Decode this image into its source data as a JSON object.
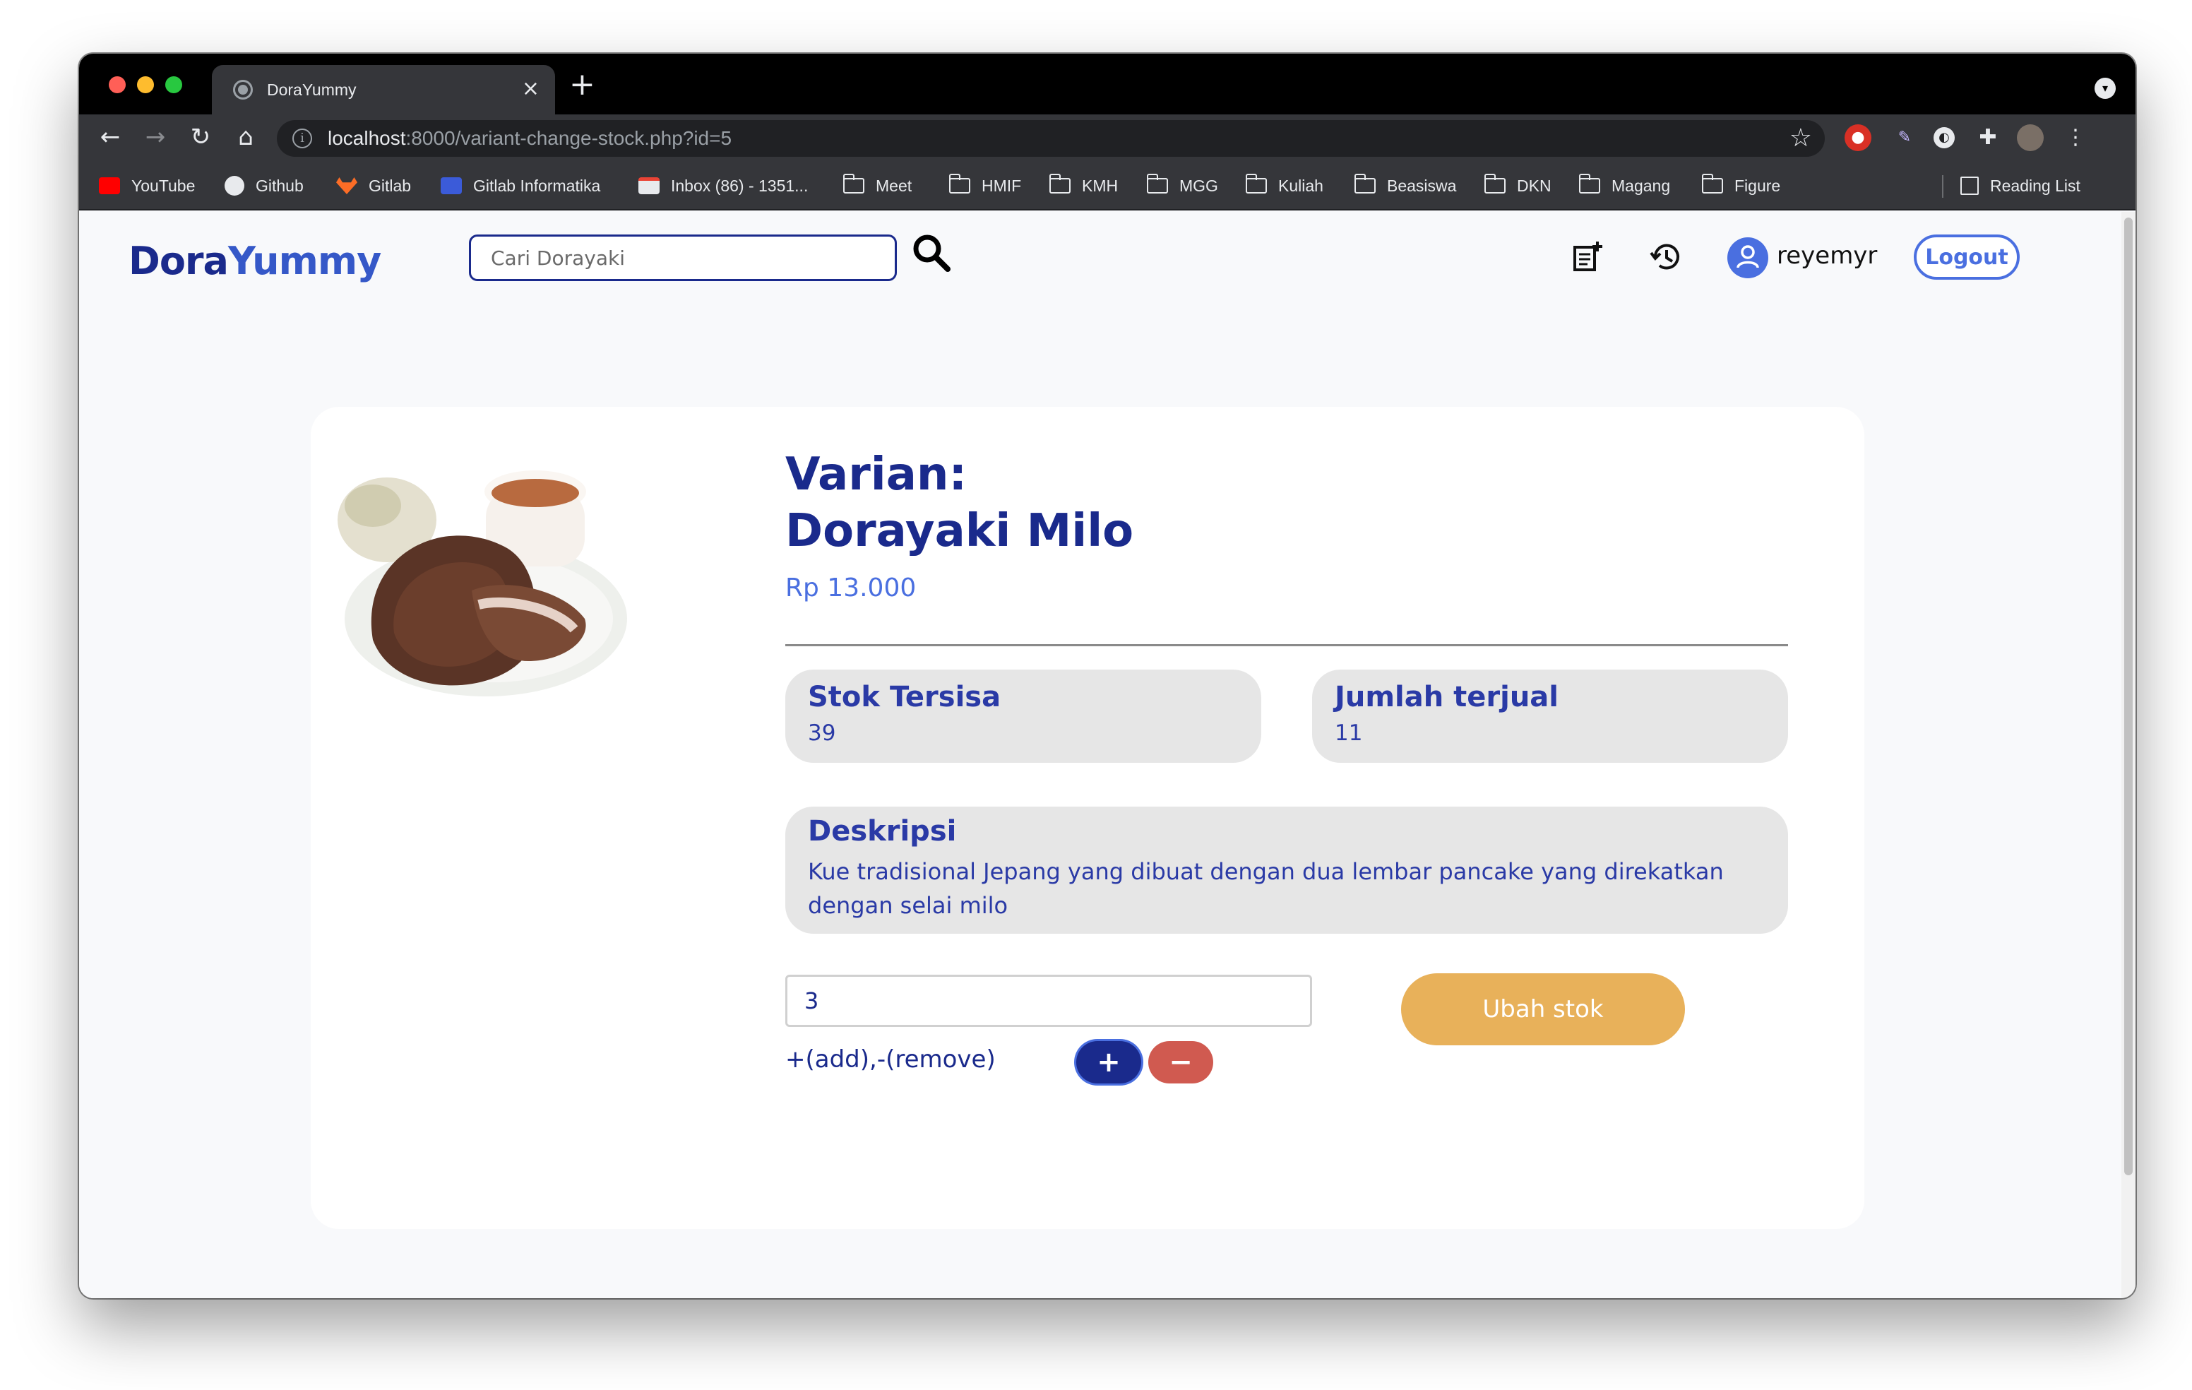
{
  "browser": {
    "tab_title": "DoraYummy",
    "url_host": "localhost",
    "url_rest": ":8000/variant-change-stock.php?id=5",
    "bookmarks": [
      {
        "label": "YouTube",
        "icon": "youtube-icon"
      },
      {
        "label": "Github",
        "icon": "github-icon"
      },
      {
        "label": "Gitlab",
        "icon": "gitlab-icon"
      },
      {
        "label": "Gitlab Informatika",
        "icon": "gitlab-informatika-icon"
      },
      {
        "label": "Inbox (86) - 1351...",
        "icon": "gmail-icon"
      },
      {
        "label": "Meet",
        "icon": "folder-icon"
      },
      {
        "label": "HMIF",
        "icon": "folder-icon"
      },
      {
        "label": "KMH",
        "icon": "folder-icon"
      },
      {
        "label": "MGG",
        "icon": "folder-icon"
      },
      {
        "label": "Kuliah",
        "icon": "folder-icon"
      },
      {
        "label": "Beasiswa",
        "icon": "folder-icon"
      },
      {
        "label": "DKN",
        "icon": "folder-icon"
      },
      {
        "label": "Magang",
        "icon": "folder-icon"
      },
      {
        "label": "Figure",
        "icon": "folder-icon"
      }
    ],
    "reading_list": "Reading List"
  },
  "header": {
    "brand_part1": "Dora",
    "brand_part2": "Yummy",
    "search_placeholder": "Cari Dorayaki",
    "username": "reyemyr",
    "logout_label": "Logout"
  },
  "product": {
    "variant_label": "Varian:",
    "variant_name": "Dorayaki Milo",
    "price": "Rp 13.000",
    "stock_title": "Stok Tersisa",
    "stock_value": "39",
    "sold_title": "Jumlah terjual",
    "sold_value": "11",
    "desc_title": "Deskripsi",
    "desc_text": "Kue tradisional Jepang yang dibuat dengan dua lembar pancake yang direkatkan dengan selai milo"
  },
  "stock_form": {
    "quantity_value": "3",
    "hint": "+(add),-(remove)",
    "add_label": "+",
    "remove_label": "−",
    "submit_label": "Ubah stok"
  },
  "colors": {
    "brand_dark": "#1a2a8c",
    "brand_light": "#4a6fe0",
    "submit": "#e8b15a",
    "remove": "#d05a50",
    "panel": "#e6e6e6"
  }
}
